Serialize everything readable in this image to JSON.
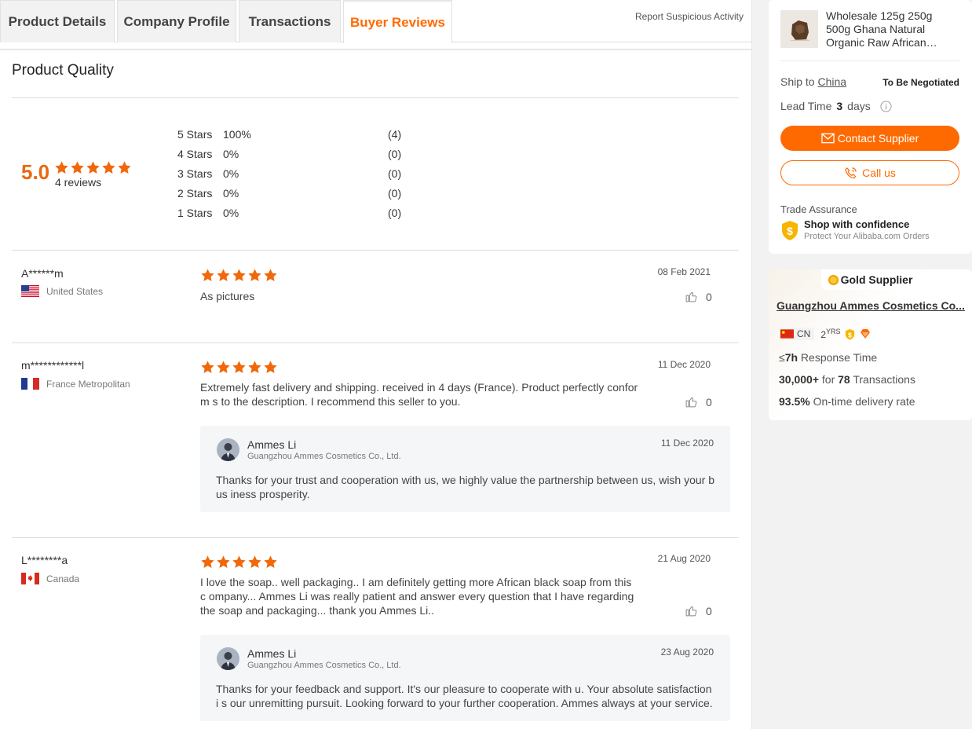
{
  "tabs": [
    {
      "label": "Product Details",
      "active": false
    },
    {
      "label": "Company Profile",
      "active": false
    },
    {
      "label": "Transactions",
      "active": false
    },
    {
      "label": "Buyer Reviews",
      "active": true
    }
  ],
  "report_link": "Report Suspicious Activity",
  "section_title": "Product Quality",
  "summary": {
    "score": "5.0",
    "stars": 5,
    "review_count": "4 reviews"
  },
  "distribution": [
    {
      "label": "5  Stars",
      "pct": "100%",
      "count": "(4)"
    },
    {
      "label": "4  Stars",
      "pct": "0%",
      "count": "(0)"
    },
    {
      "label": "3  Stars",
      "pct": "0%",
      "count": "(0)"
    },
    {
      "label": "2  Stars",
      "pct": "0%",
      "count": "(0)"
    },
    {
      "label": "1  Stars",
      "pct": "0%",
      "count": "(0)"
    }
  ],
  "reviews": [
    {
      "name": "A******m",
      "country": "United States",
      "flag": "us",
      "stars": 5,
      "date": "08 Feb 2021",
      "text": "As pictures",
      "likes": "0"
    },
    {
      "name": "m************l",
      "country": "France Metropolitan",
      "flag": "fr",
      "stars": 5,
      "date": "11 Dec 2020",
      "text": "Extremely fast delivery and shipping. received in 4 days (France). Product perfectly conform s to the description. I recommend this seller to you.",
      "likes": "0",
      "reply": {
        "name": "Ammes Li",
        "company": "Guangzhou Ammes Cosmetics Co., Ltd.",
        "date": "11 Dec 2020",
        "text": "Thanks for your trust and cooperation with us, we highly value the partnership between us, wish your bus iness prosperity."
      }
    },
    {
      "name": "L********a",
      "country": "Canada",
      "flag": "ca",
      "stars": 5,
      "date": "21 Aug 2020",
      "text": "I love the soap.. well packaging.. I am definitely getting more African black soap from this c ompany... Ammes Li was really patient and answer every question that I have regarding the soap and packaging... thank you Ammes Li..",
      "likes": "0",
      "reply": {
        "name": "Ammes Li",
        "company": "Guangzhou Ammes Cosmetics Co., Ltd.",
        "date": "23 Aug 2020",
        "text": "Thanks for your feedback and support. It's our pleasure to cooperate with u. Your absolute satisfaction i s our unremitting pursuit. Looking forward to your further cooperation. Ammes always at your service."
      }
    }
  ],
  "product": {
    "title": "Wholesale 125g 250g 500g Ghana Natural Organic Raw African…",
    "ship_label": "Ship to",
    "ship_country": "China",
    "negotiated": "To Be Negotiated",
    "lead_label": "Lead Time",
    "lead_value": "3",
    "lead_unit": "days",
    "contact_label": "Contact Supplier",
    "call_label": "Call us",
    "trade_assurance": "Trade Assurance",
    "ta_title": "Shop with confidence",
    "ta_sub": "Protect Your Alibaba.com Orders"
  },
  "supplier": {
    "badge": "Gold Supplier",
    "name": "Guangzhou Ammes Cosmetics Co...",
    "country": "CN",
    "years": "2",
    "years_unit": "YRS",
    "response_prefix": "≤",
    "response_value": "7h",
    "response_label": "Response Time",
    "transactions_amount": "30,000+",
    "transactions_for": "for",
    "transactions_count": "78",
    "transactions_label": "Transactions",
    "ontime_value": "93.5%",
    "ontime_label": "On-time delivery rate"
  },
  "colors": {
    "accent": "#ff6a00",
    "star": "#f0680a",
    "text": "#333333"
  }
}
